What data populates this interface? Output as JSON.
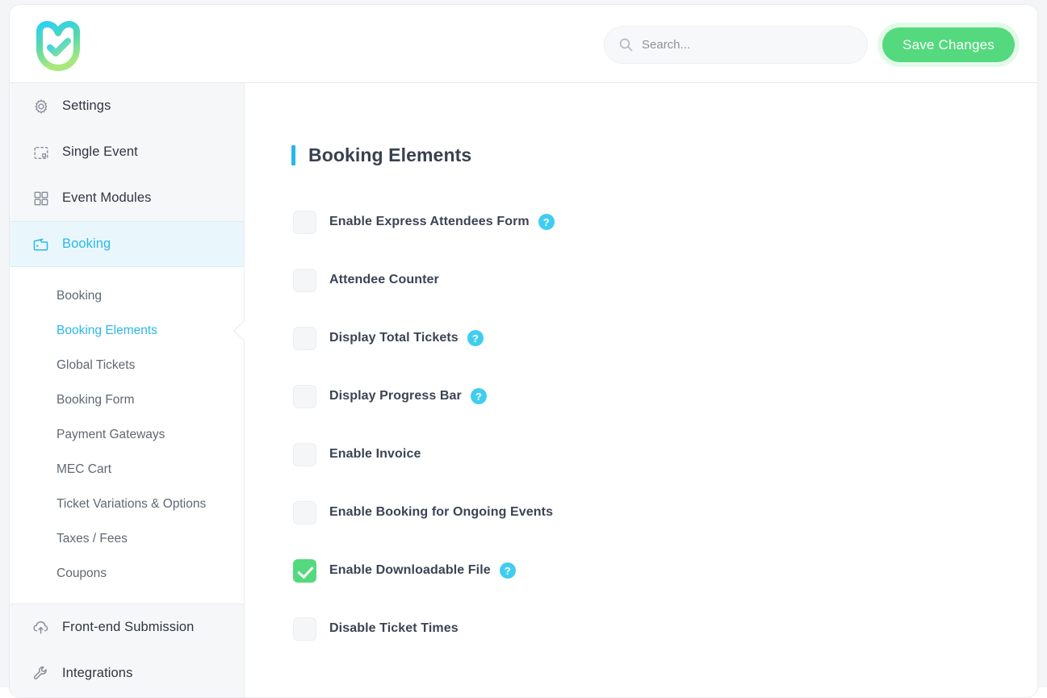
{
  "brand": {
    "logo_name": "mec-shield-check-logo",
    "accent_blue": "#2ab7ea",
    "accent_green": "#54d97e",
    "help_icon_color": "#41cdf0"
  },
  "header": {
    "search": {
      "placeholder": "Search...",
      "value": "",
      "icon": "search-icon"
    },
    "save_label": "Save Changes"
  },
  "sidebar": {
    "items": [
      {
        "label": "Settings",
        "icon": "gear-icon",
        "active": false
      },
      {
        "label": "Single Event",
        "icon": "calendar-icon",
        "active": false
      },
      {
        "label": "Event Modules",
        "icon": "grid-icon",
        "active": false
      },
      {
        "label": "Booking",
        "icon": "folder-icon",
        "active": true
      }
    ],
    "submenu": [
      {
        "label": "Booking",
        "active": false
      },
      {
        "label": "Booking Elements",
        "active": true
      },
      {
        "label": "Global Tickets",
        "active": false
      },
      {
        "label": "Booking Form",
        "active": false
      },
      {
        "label": "Payment Gateways",
        "active": false
      },
      {
        "label": "MEC Cart",
        "active": false
      },
      {
        "label": "Ticket Variations & Options",
        "active": false
      },
      {
        "label": "Taxes / Fees",
        "active": false
      },
      {
        "label": "Coupons",
        "active": false
      }
    ],
    "bottom_items": [
      {
        "label": "Front-end Submission",
        "icon": "cloud-upload-icon",
        "active": false
      },
      {
        "label": "Integrations",
        "icon": "wrench-icon",
        "active": false
      }
    ]
  },
  "main": {
    "title": "Booking Elements",
    "options": [
      {
        "label": "Enable Express Attendees Form",
        "checked": false,
        "help": true
      },
      {
        "label": "Attendee Counter",
        "checked": false,
        "help": false
      },
      {
        "label": "Display Total Tickets",
        "checked": false,
        "help": true
      },
      {
        "label": "Display Progress Bar",
        "checked": false,
        "help": true
      },
      {
        "label": "Enable Invoice",
        "checked": false,
        "help": false
      },
      {
        "label": "Enable Booking for Ongoing Events",
        "checked": false,
        "help": false
      },
      {
        "label": "Enable Downloadable File",
        "checked": true,
        "help": true
      },
      {
        "label": "Disable Ticket Times",
        "checked": false,
        "help": false
      }
    ],
    "help_glyph": "?"
  }
}
